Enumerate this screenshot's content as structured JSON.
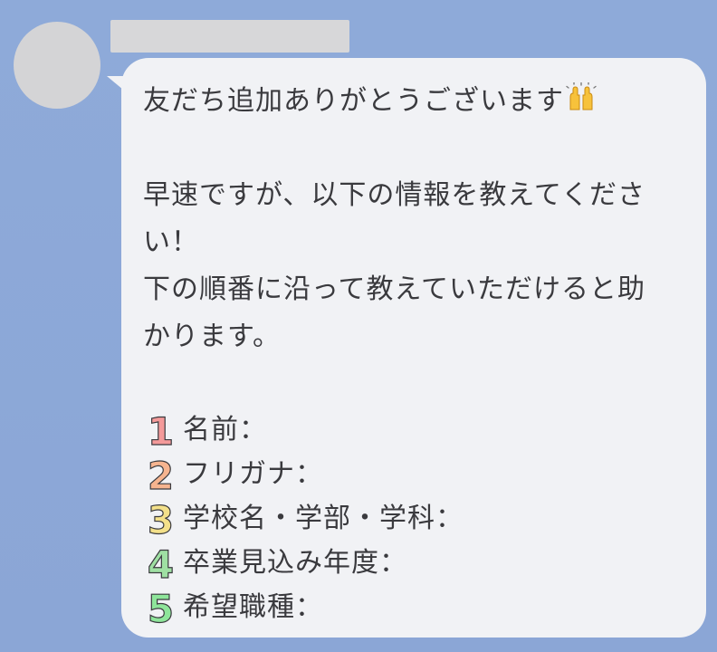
{
  "chat": {
    "greeting": "友だち追加ありがとうございます",
    "greeting_emoji": "raising-hands-emoji",
    "request_line1": "早速ですが、以下の情報を教えてくださ",
    "request_line2": "い！",
    "instruction_line1": "下の順番に沿って教えていただけると助",
    "instruction_line2": "かります。",
    "items": [
      {
        "number": "1",
        "label": "名前：",
        "color": "#f49a9a"
      },
      {
        "number": "2",
        "label": "フリガナ：",
        "color": "#f6b48f"
      },
      {
        "number": "3",
        "label": "学校名・学部・学科：",
        "color": "#f3e08a"
      },
      {
        "number": "4",
        "label": "卒業見込み年度：",
        "color": "#9fe0a3"
      },
      {
        "number": "5",
        "label": "希望職種：",
        "color": "#8ee59a"
      }
    ]
  },
  "colors": {
    "background": "#8eaad9",
    "bubble": "#f1f2f5",
    "text": "#3a3a3e",
    "avatar_placeholder": "#d4d4d6"
  }
}
